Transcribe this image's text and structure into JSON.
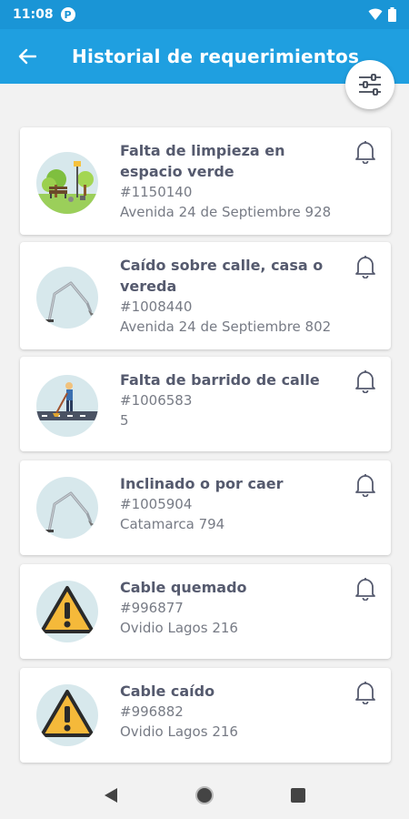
{
  "status_bar": {
    "time": "11:08",
    "app_icon_letter": "P"
  },
  "app_bar": {
    "title": "Historial de requerimientos",
    "back_icon": "arrow-left-icon",
    "filter_icon": "sliders-icon"
  },
  "colors": {
    "primary": "#1f9fe0",
    "status_bar": "#1a95d6",
    "title_text": "#555a6e",
    "secondary_text": "#777b85"
  },
  "requests": [
    {
      "title_lines": [
        "Falta de limpieza en",
        "espacio verde"
      ],
      "number": "#1150140",
      "address": "Avenida 24 de Septiembre 928",
      "icon": "park-icon"
    },
    {
      "title_lines": [
        "Caído sobre calle, casa o",
        "vereda"
      ],
      "number": "#1008440",
      "address": "Avenida 24 de Septiembre 802",
      "icon": "streetlight-icon"
    },
    {
      "title_lines": [
        "Falta de barrido de calle"
      ],
      "number": "#1006583",
      "address": "5",
      "icon": "street-sweeper-icon"
    },
    {
      "title_lines": [
        "Inclinado o por caer"
      ],
      "number": "#1005904",
      "address": "Catamarca 794",
      "icon": "streetlight-icon"
    },
    {
      "title_lines": [
        "Cable quemado"
      ],
      "number": "#996877",
      "address": "Ovidio Lagos 216",
      "icon": "warning-icon"
    },
    {
      "title_lines": [
        "Cable caído"
      ],
      "number": "#996882",
      "address": "Ovidio Lagos 216",
      "icon": "warning-icon"
    }
  ]
}
